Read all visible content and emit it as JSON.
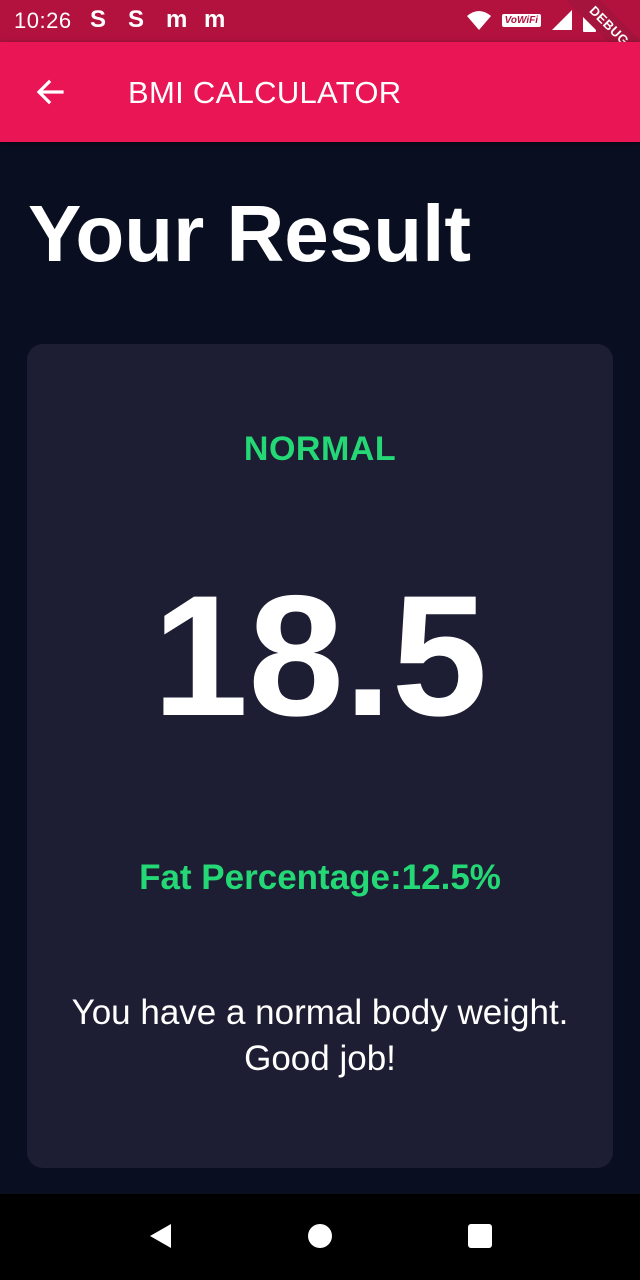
{
  "status_bar": {
    "time": "10:26",
    "notifications": [
      "S",
      "S",
      "m",
      "m"
    ],
    "network_label": "VoWiFi",
    "icons": [
      "wifi-icon",
      "signal-icon",
      "battery-icon"
    ]
  },
  "debug_banner": "DEBUG",
  "app_bar": {
    "title": "BMI CALCULATOR",
    "back_icon": "arrow-back-icon",
    "color": "#e91555"
  },
  "page": {
    "title": "Your Result"
  },
  "result": {
    "status": "NORMAL",
    "bmi": "18.5",
    "fat_percentage": "Fat Percentage:12.5%",
    "interpretation": "You have a normal body weight. Good job!",
    "accent_color": "#24d876",
    "card_color": "#1d1e33"
  },
  "navigation": {
    "icons": [
      "back-triangle-icon",
      "home-circle-icon",
      "recents-square-icon"
    ]
  }
}
